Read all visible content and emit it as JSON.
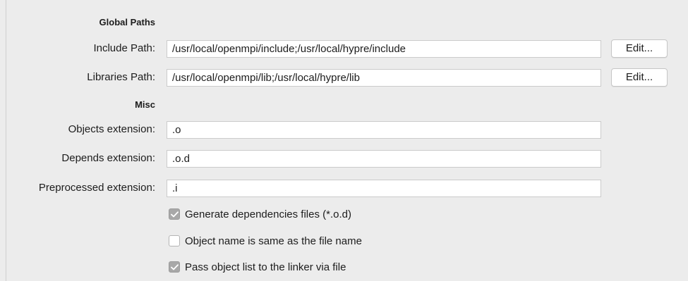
{
  "global_paths": {
    "heading": "Global Paths",
    "include": {
      "label": "Include Path:",
      "value": "/usr/local/openmpi/include;/usr/local/hypre/include",
      "edit_label": "Edit..."
    },
    "libraries": {
      "label": "Libraries Path:",
      "value": "/usr/local/openmpi/lib;/usr/local/hypre/lib",
      "edit_label": "Edit..."
    }
  },
  "misc": {
    "heading": "Misc",
    "objects": {
      "label": "Objects extension:",
      "value": ".o"
    },
    "depends": {
      "label": "Depends extension:",
      "value": ".o.d"
    },
    "preprocessed": {
      "label": "Preprocessed extension:",
      "value": ".i"
    },
    "checkboxes": [
      {
        "label": "Generate dependencies files (*.o.d)",
        "checked": true
      },
      {
        "label": "Object name is same as the file name",
        "checked": false
      },
      {
        "label": "Pass object list to the linker via file",
        "checked": true
      }
    ]
  }
}
